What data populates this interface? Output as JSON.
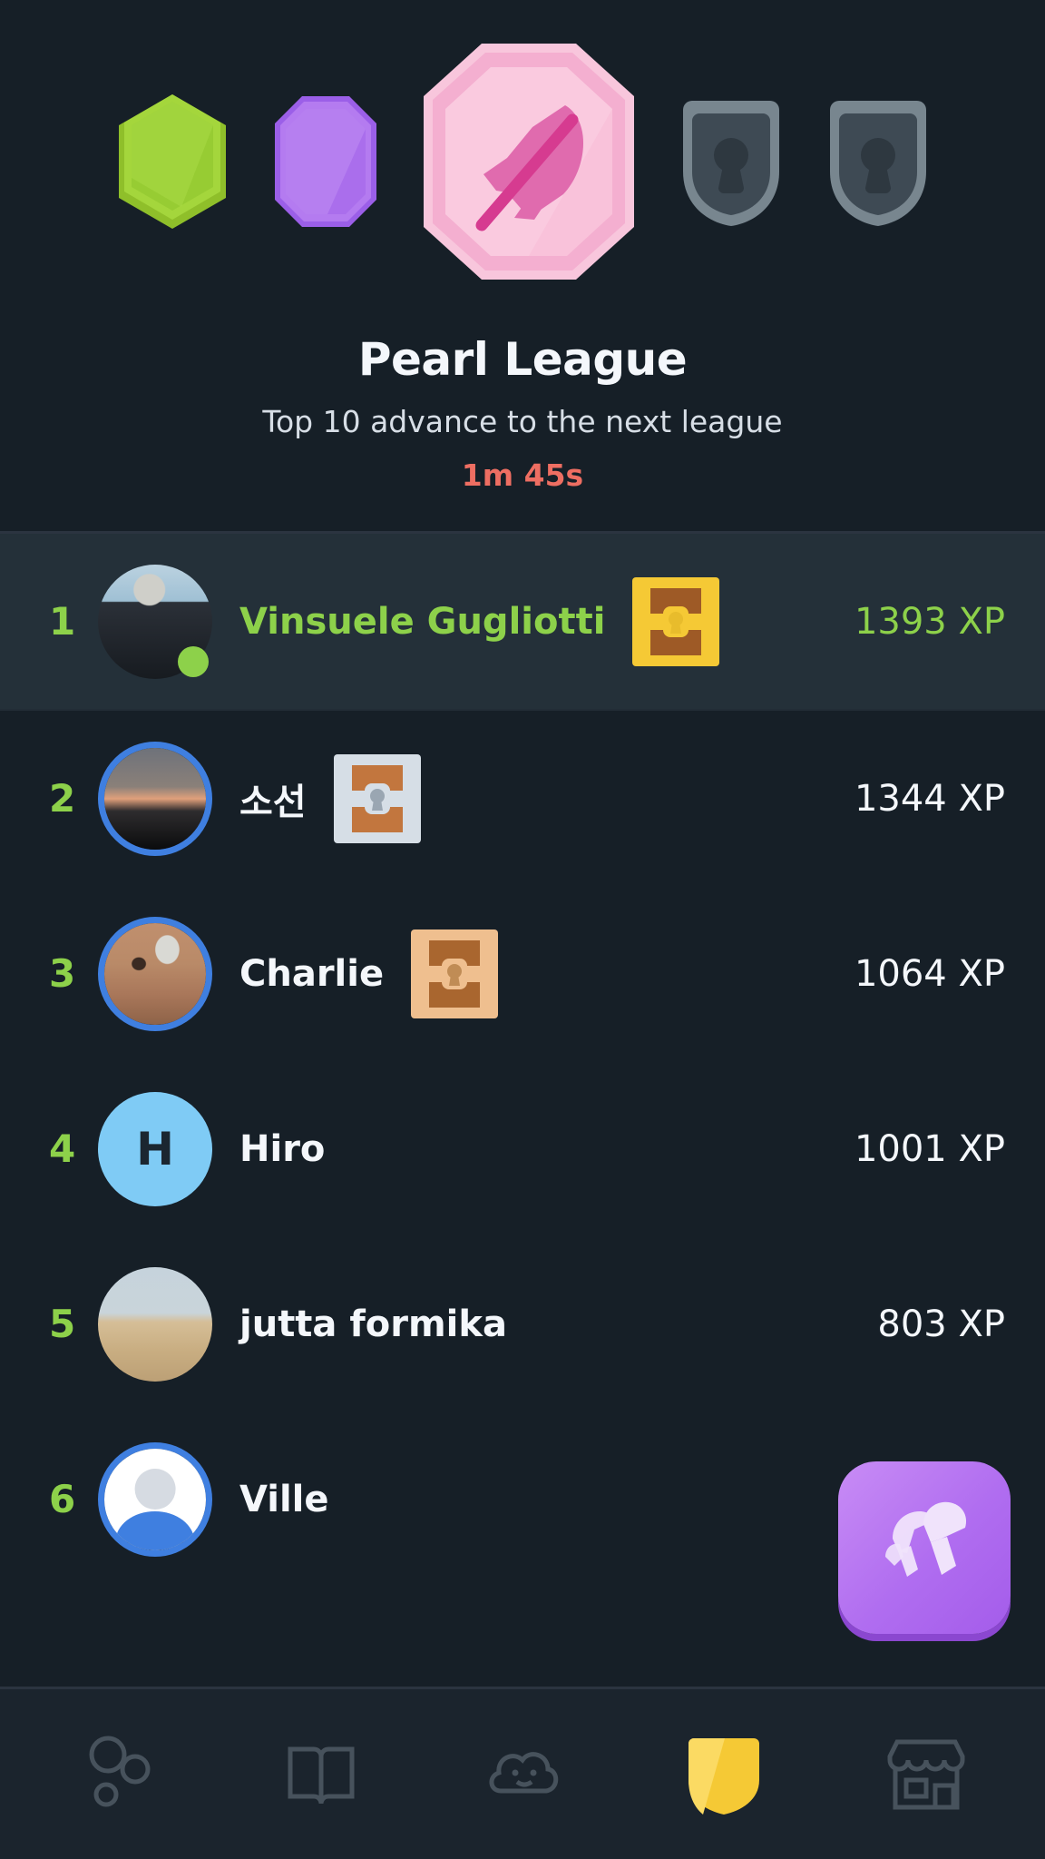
{
  "league": {
    "title": "Pearl League",
    "subtitle": "Top 10 advance to the next league",
    "timer": "1m 45s",
    "timer_color": "#EE6E62",
    "accent_green": "#8DD14A",
    "badges": [
      {
        "name": "ruby-league-badge",
        "state": "unlocked",
        "shape": "hexagon",
        "color": "#A4D63C",
        "size": "small"
      },
      {
        "name": "amethyst-league-badge",
        "state": "unlocked",
        "shape": "octagon",
        "color": "#B47BF0",
        "size": "small"
      },
      {
        "name": "pearl-league-badge",
        "state": "current",
        "shape": "octagon",
        "color": "#F4AFD0",
        "size": "large",
        "icon": "feather-icon"
      },
      {
        "name": "locked-league-badge-1",
        "state": "locked",
        "shape": "shield",
        "color": "#78868F",
        "size": "small",
        "icon": "keyhole-icon"
      },
      {
        "name": "locked-league-badge-2",
        "state": "locked",
        "shape": "shield",
        "color": "#78868F",
        "size": "small",
        "icon": "keyhole-icon"
      }
    ]
  },
  "leaderboard": {
    "rows": [
      {
        "rank": "1",
        "name": "Vinsuele Gugliotti",
        "xp": "1393 XP",
        "highlight": true,
        "online": true,
        "chest": "gold",
        "avatar_type": "photo",
        "avatar_class": "ph-v1",
        "ringed": false
      },
      {
        "rank": "2",
        "name": "소선",
        "xp": "1344 XP",
        "highlight": false,
        "online": false,
        "chest": "silver",
        "avatar_type": "photo",
        "avatar_class": "ph-v2",
        "ringed": true
      },
      {
        "rank": "3",
        "name": "Charlie",
        "xp": "1064 XP",
        "highlight": false,
        "online": false,
        "chest": "bronze",
        "avatar_type": "photo",
        "avatar_class": "ph-v3",
        "ringed": true
      },
      {
        "rank": "4",
        "name": "Hiro",
        "xp": "1001 XP",
        "highlight": false,
        "online": false,
        "chest": "none",
        "avatar_type": "initial",
        "initial": "H",
        "ringed": false
      },
      {
        "rank": "5",
        "name": "jutta formika",
        "xp": "803 XP",
        "highlight": false,
        "online": false,
        "chest": "none",
        "avatar_type": "photo",
        "avatar_class": "ph-v5",
        "ringed": false
      },
      {
        "rank": "6",
        "name": "Ville",
        "xp": "",
        "highlight": false,
        "online": false,
        "chest": "none",
        "avatar_type": "photo",
        "avatar_class": "ph-v6",
        "ringed": true
      }
    ]
  },
  "fab": {
    "name": "boost-button",
    "icon": "mushrooms-icon",
    "color": "#B06DF0"
  },
  "nav": {
    "items": [
      {
        "name": "nav-learn",
        "icon": "circles-icon",
        "active": false
      },
      {
        "name": "nav-practice",
        "icon": "book-icon",
        "active": false
      },
      {
        "name": "nav-characters",
        "icon": "cloud-face-icon",
        "active": false
      },
      {
        "name": "nav-leaderboard",
        "icon": "shield-icon",
        "active": true
      },
      {
        "name": "nav-shop",
        "icon": "store-icon",
        "active": false
      }
    ],
    "active_color": "#F5C935"
  }
}
